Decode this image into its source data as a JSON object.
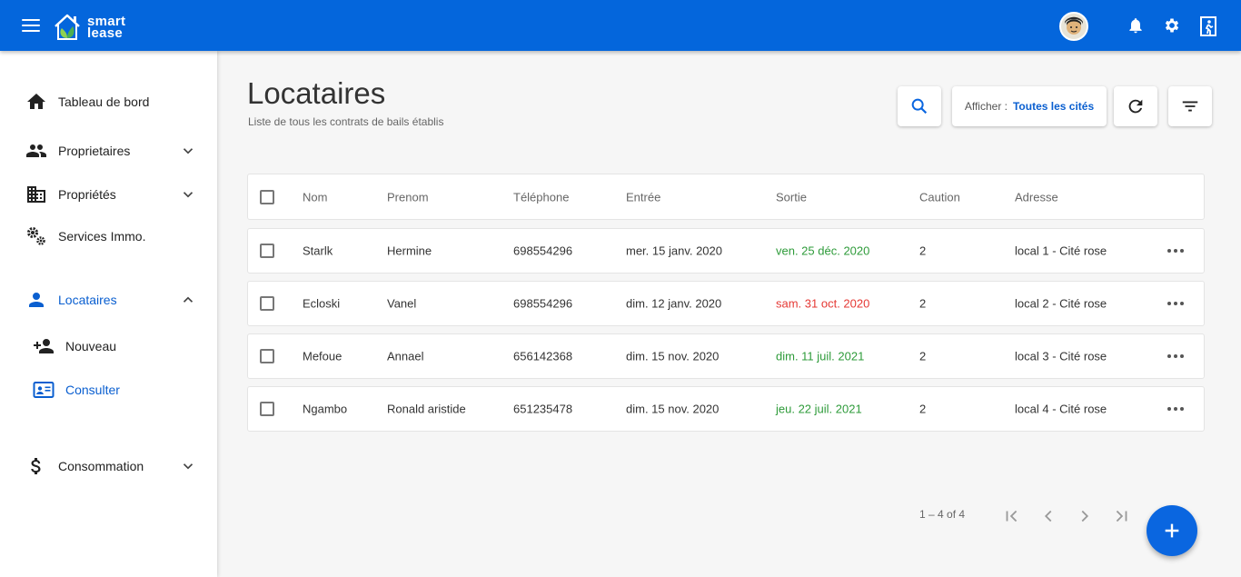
{
  "app": {
    "logo_line1": "smart",
    "logo_line2": "lease"
  },
  "sidebar": {
    "items": [
      {
        "label": "Tableau de bord",
        "icon": "home-icon"
      },
      {
        "label": "Proprietaires",
        "icon": "people-icon",
        "expandable": true
      },
      {
        "label": "Propriétés",
        "icon": "building-icon",
        "expandable": true
      },
      {
        "label": "Services Immo.",
        "icon": "gears-icon"
      },
      {
        "label": "Locataires",
        "icon": "person-icon",
        "expanded": true,
        "active": true
      },
      {
        "label": "Nouveau",
        "icon": "person-add-icon",
        "sub": true
      },
      {
        "label": "Consulter",
        "icon": "id-card-icon",
        "sub": true,
        "active": true
      },
      {
        "label": "Consommation",
        "icon": "dollar-icon",
        "expandable": true
      }
    ]
  },
  "header": {
    "title": "Locataires",
    "subtitle": "Liste de tous les contrats de bails établis",
    "filter_key": "Afficher :",
    "filter_value": "Toutes les cités"
  },
  "table": {
    "columns": [
      "Nom",
      "Prenom",
      "Téléphone",
      "Entrée",
      "Sortie",
      "Caution",
      "Adresse"
    ],
    "rows": [
      {
        "nom": "Starlk",
        "prenom": "Hermine",
        "tel": "698554296",
        "entree": "mer. 15 janv. 2020",
        "sortie": "ven. 25 déc. 2020",
        "sortie_status": "green",
        "caution": "2",
        "adresse": "local 1 - Cité rose"
      },
      {
        "nom": "Ecloski",
        "prenom": "Vanel",
        "tel": "698554296",
        "entree": "dim. 12 janv. 2020",
        "sortie": "sam. 31 oct. 2020",
        "sortie_status": "red",
        "caution": "2",
        "adresse": "local 2 - Cité rose"
      },
      {
        "nom": "Mefoue",
        "prenom": "Annael",
        "tel": "656142368",
        "entree": "dim. 15 nov. 2020",
        "sortie": "dim. 11 juil. 2021",
        "sortie_status": "green",
        "caution": "2",
        "adresse": "local 3 - Cité rose"
      },
      {
        "nom": "Ngambo",
        "prenom": "Ronald aristide",
        "tel": "651235478",
        "entree": "dim. 15 nov. 2020",
        "sortie": "jeu. 22 juil. 2021",
        "sortie_status": "green",
        "caution": "2",
        "adresse": "local 4 - Cité rose"
      }
    ]
  },
  "paginator": {
    "range": "1 – 4 of 4"
  },
  "colors": {
    "primary": "#0466dc",
    "active": "#0a5fd0",
    "ok": "#2e9b3a",
    "overdue": "#e53935"
  }
}
